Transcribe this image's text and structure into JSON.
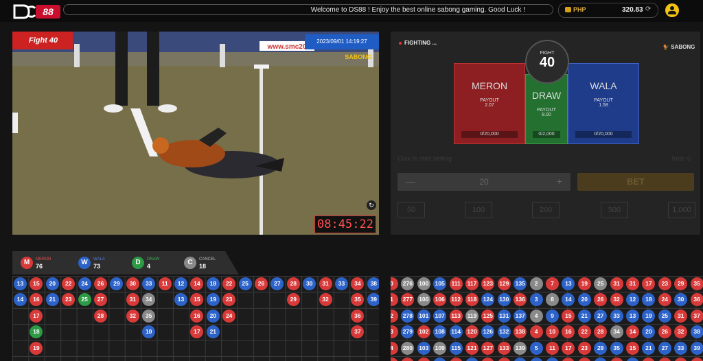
{
  "header": {
    "ticker": "Welcome to DS88 !  Enjoy the best online sabong gaming. Good Luck !",
    "currency": "PHP",
    "balance": "320.83",
    "logo_icon": "ds88-logo",
    "user_icon": "user-icon"
  },
  "video": {
    "fight_label": "Fight 40",
    "datetime": "2023/09/01 14:19:27",
    "timer": "08:45:22",
    "watermark": "www.smc20",
    "channel_logo": "SABONG"
  },
  "betting": {
    "status": "FIGHTING ...",
    "brand": "SABONG",
    "fight_title": "FIGHT",
    "fight_number": "40",
    "meron": {
      "name": "MERON",
      "payout_label": "PAYOUT",
      "payout": "2.07",
      "limit": "0/20,000"
    },
    "draw": {
      "name": "DRAW",
      "payout_label": "PAYOUT",
      "payout": "8.00",
      "limit": "0/2,000"
    },
    "wala": {
      "name": "WALA",
      "payout_label": "PAYOUT",
      "payout": "1.58",
      "limit": "0/20,000"
    },
    "hint": "Click to start betting",
    "total_label": "Total",
    "total_value": "0",
    "stepper_minus": "—",
    "stepper_plus": "+",
    "amount": "20",
    "bet_button": "BET",
    "chips": [
      "50",
      "100",
      "200",
      "500",
      "1,000"
    ]
  },
  "summary": {
    "meron": {
      "badge": "M",
      "label": "MERON",
      "count": "76",
      "color": "#d83a3a"
    },
    "wala": {
      "badge": "W",
      "label": "WALA",
      "count": "73",
      "color": "#2d63c9"
    },
    "draw": {
      "badge": "D",
      "label": "DRAW",
      "count": "4",
      "color": "#2d9a45"
    },
    "cancel": {
      "badge": "C",
      "label": "CANCEL",
      "count": "18",
      "color": "#8a8a8a"
    }
  },
  "road_left": [
    [
      {
        "n": "13",
        "c": "blue"
      },
      {
        "n": "14",
        "c": "blue"
      }
    ],
    [
      {
        "n": "15",
        "c": "red"
      },
      {
        "n": "16",
        "c": "red"
      },
      {
        "n": "17",
        "c": "red"
      },
      {
        "n": "18",
        "c": "green"
      },
      {
        "n": "19",
        "c": "red"
      }
    ],
    [
      {
        "n": "20",
        "c": "blue"
      },
      {
        "n": "21",
        "c": "blue"
      }
    ],
    [
      {
        "n": "22",
        "c": "red"
      },
      {
        "n": "23",
        "c": "red"
      }
    ],
    [
      {
        "n": "24",
        "c": "blue"
      },
      {
        "n": "25",
        "c": "green"
      }
    ],
    [
      {
        "n": "26",
        "c": "red"
      },
      {
        "n": "27",
        "c": "red"
      },
      {
        "n": "28",
        "c": "red"
      }
    ],
    [
      {
        "n": "29",
        "c": "blue"
      }
    ],
    [
      {
        "n": "30",
        "c": "red"
      },
      {
        "n": "31",
        "c": "red"
      },
      {
        "n": "32",
        "c": "red"
      }
    ],
    [
      {
        "n": "33",
        "c": "blue"
      },
      {
        "n": "34",
        "c": "gray"
      },
      {
        "n": "35",
        "c": "gray"
      },
      {
        "n": "10",
        "c": "blue"
      }
    ],
    [
      {
        "n": "11",
        "c": "red"
      }
    ],
    [
      {
        "n": "12",
        "c": "blue"
      },
      {
        "n": "13",
        "c": "blue"
      }
    ],
    [
      {
        "n": "14",
        "c": "red"
      },
      {
        "n": "15",
        "c": "red"
      },
      {
        "n": "16",
        "c": "red"
      },
      {
        "n": "17",
        "c": "red"
      }
    ],
    [
      {
        "n": "18",
        "c": "blue"
      },
      {
        "n": "19",
        "c": "blue"
      },
      {
        "n": "20",
        "c": "blue"
      },
      {
        "n": "21",
        "c": "blue"
      }
    ],
    [
      {
        "n": "22",
        "c": "red"
      },
      {
        "n": "23",
        "c": "red"
      },
      {
        "n": "24",
        "c": "red"
      }
    ],
    [
      {
        "n": "25",
        "c": "blue"
      }
    ],
    [
      {
        "n": "26",
        "c": "red"
      }
    ],
    [
      {
        "n": "27",
        "c": "blue"
      }
    ],
    [
      {
        "n": "28",
        "c": "red"
      },
      {
        "n": "29",
        "c": "red"
      }
    ],
    [
      {
        "n": "30",
        "c": "blue"
      }
    ],
    [
      {
        "n": "31",
        "c": "red"
      },
      {
        "n": "32",
        "c": "red"
      }
    ],
    [
      {
        "n": "33",
        "c": "blue"
      }
    ],
    [
      {
        "n": "34",
        "c": "red"
      },
      {
        "n": "35",
        "c": "red"
      },
      {
        "n": "36",
        "c": "red"
      },
      {
        "n": "37",
        "c": "red"
      }
    ],
    [
      {
        "n": "38",
        "c": "blue"
      },
      {
        "n": "39",
        "c": "blue"
      }
    ]
  ],
  "road_right": [
    [
      "0:r",
      "1:r",
      "2:r",
      "3:r",
      "4:r",
      "5:r"
    ],
    [
      "276:g",
      "277:r",
      "278:b",
      "279:b",
      "280:g",
      "281:r"
    ],
    [
      "100:g",
      "100:g",
      "101:b",
      "102:r",
      "103:b",
      "104:r"
    ],
    [
      "105:b",
      "106:r",
      "107:b",
      "108:b",
      "109:g",
      "110:b"
    ],
    [
      "111:r",
      "112:r",
      "113:r",
      "114:b",
      "115:b",
      "116:r"
    ],
    [
      "117:r",
      "118:r",
      "119:g",
      "120:r",
      "121:r",
      "122:b"
    ],
    [
      "123:r",
      "124:b",
      "125:r",
      "126:b",
      "127:r",
      "128:r"
    ],
    [
      "129:r",
      "130:b",
      "131:b",
      "132:b",
      "133:r",
      "134:r"
    ],
    [
      "135:b",
      "136:r",
      "137:b",
      "138:r",
      "139:g",
      "140:b"
    ],
    [
      "2:g",
      "3:b",
      "4:g",
      "4:r",
      "5:b",
      "6:b"
    ],
    [
      "7:r",
      "8:g",
      "9:b",
      "10:r",
      "11:r",
      "12:b"
    ],
    [
      "13:b",
      "14:b",
      "15:r",
      "16:r",
      "17:r",
      "18:r"
    ],
    [
      "19:r",
      "20:b",
      "21:b",
      "22:r",
      "23:r",
      "24:r"
    ],
    [
      "25:g",
      "26:r",
      "27:b",
      "28:r",
      "29:b",
      "30:b"
    ],
    [
      "31:r",
      "32:r",
      "33:b",
      "34:g",
      "35:b",
      "36:r"
    ],
    [
      "31:r",
      "12:b",
      "13:b",
      "14:r",
      "15:r",
      "16:b"
    ],
    [
      "17:r",
      "18:b",
      "19:b",
      "20:b",
      "21:b",
      "22:r"
    ],
    [
      "23:r",
      "24:r",
      "25:b",
      "26:r",
      "27:b",
      "28:r"
    ],
    [
      "29:r",
      "30:b",
      "31:r",
      "32:r",
      "33:b",
      "34:r"
    ],
    [
      "35:r",
      "36:r",
      "37:r",
      "38:b",
      "39:b",
      "40:r"
    ]
  ]
}
